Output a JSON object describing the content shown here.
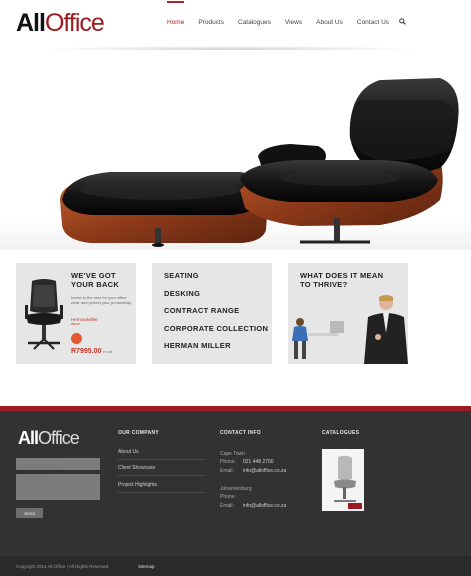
{
  "brand": {
    "logo_part1": "All",
    "logo_part2": "Office",
    "accent_color": "#9b1b22"
  },
  "nav": {
    "items": [
      {
        "label": "Home",
        "active": true
      },
      {
        "label": "Products",
        "active": false
      },
      {
        "label": "Catalogues",
        "active": false
      },
      {
        "label": "Views",
        "active": false
      },
      {
        "label": "About Us",
        "active": false
      },
      {
        "label": "Contact Us",
        "active": false
      }
    ],
    "search_icon": "search-icon"
  },
  "promo": {
    "card1": {
      "title": "WE'VE GOT YOUR BACK",
      "description": "Invest in the best for your office chair and protect your productivity.",
      "brand": "HermanMiller",
      "brand_sub": "Aeron",
      "price": "R7995.00",
      "price_note": "ex vat"
    },
    "card2": {
      "items": [
        "SEATING",
        "DESKING",
        "CONTRACT RANGE",
        "CORPORATE COLLECTION",
        "HERMAN MILLER"
      ]
    },
    "card3": {
      "title": "WHAT DOES IT MEAN TO THRIVE?"
    }
  },
  "footer": {
    "logo_part1": "All",
    "logo_part2": "Office",
    "email_placeholder": "Your Email address",
    "message_placeholder": "Your message",
    "send_label": "Send",
    "company": {
      "title": "OUR COMPANY",
      "links": [
        "About Us",
        "Client Showcase",
        "Project Highlights"
      ]
    },
    "contact": {
      "title": "CONTACT INFO",
      "cape_town": "Cape Town",
      "phone_label": "Phone:",
      "phone_ct": "021 448 2700",
      "email_label": "Email:",
      "email_ct": "info@alloffice.co.za",
      "johannesburg": "Johannesburg",
      "phone_jhb": "",
      "email_jhb": "info@alloffice.co.za"
    },
    "catalogues": {
      "title": "CATALOGUES"
    },
    "copyright": "Copyright 2014 All Office | All Rights Reserved",
    "sitemap": "Sitemap"
  }
}
